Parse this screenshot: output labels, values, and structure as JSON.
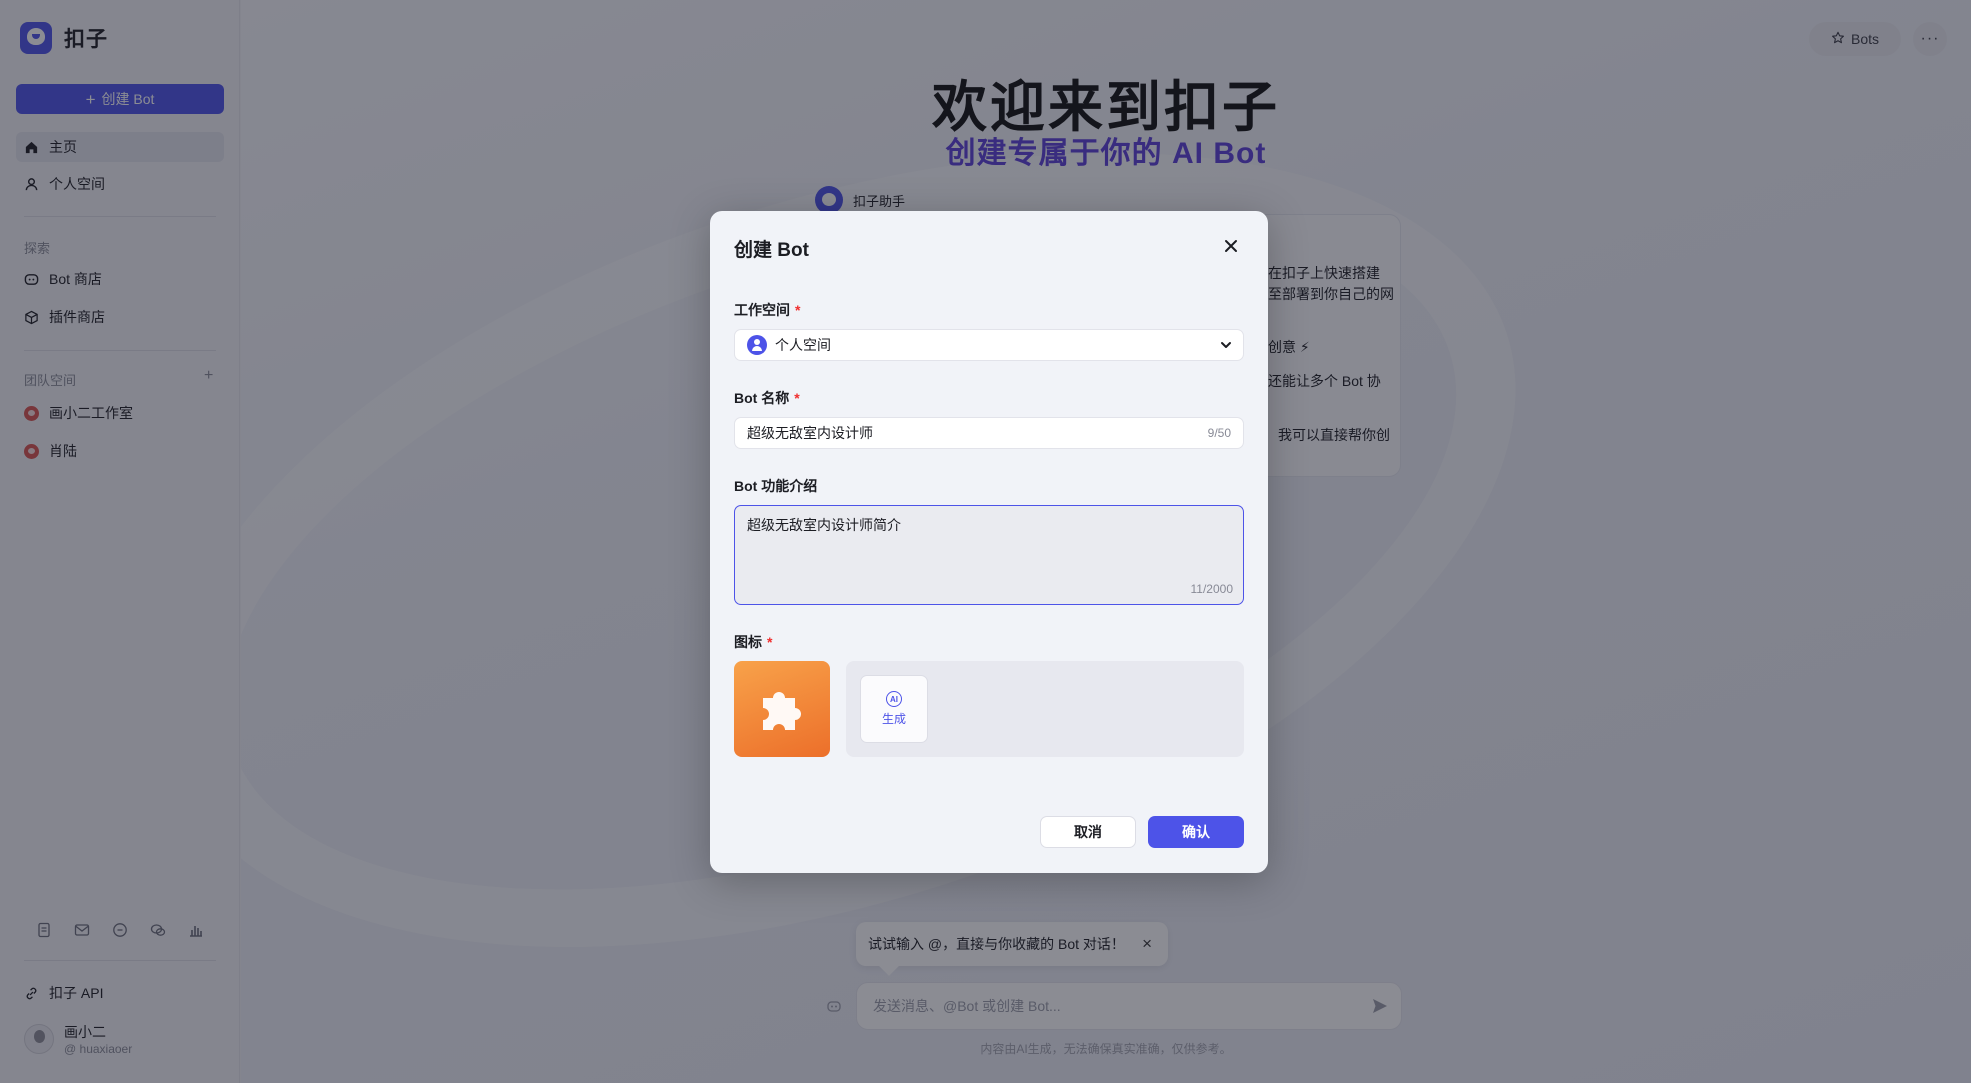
{
  "brand": {
    "name": "扣子"
  },
  "sidebar": {
    "create_label": "创建 Bot",
    "nav": [
      {
        "label": "主页",
        "icon": "home-icon",
        "active": true
      },
      {
        "label": "个人空间",
        "icon": "user-icon"
      }
    ],
    "explore_title": "探索",
    "explore": [
      {
        "label": "Bot 商店",
        "icon": "bot-icon"
      },
      {
        "label": "插件商店",
        "icon": "cube-icon"
      }
    ],
    "team_title": "团队空间",
    "team_add": "+",
    "teams": [
      {
        "label": "画小二工作室"
      },
      {
        "label": "肖陆"
      }
    ],
    "api_label": "扣子 API",
    "user": {
      "name": "画小二",
      "handle": "@ huaxiaoer"
    }
  },
  "header": {
    "bots_label": "Bots",
    "more_label": "···"
  },
  "hero": {
    "title": "欢迎来到扣子",
    "subtitle": "创建专属于你的 AI Bot"
  },
  "assistant": {
    "name": "扣子助手",
    "lines": [
      "在扣子上快速搭建",
      "至部署到你自己的网",
      "创意 ⚡",
      "还能让多个 Bot 协",
      "我可以直接帮你创"
    ]
  },
  "chat": {
    "tip": "试试输入 @，直接与你收藏的 Bot 对话！",
    "placeholder": "发送消息、@Bot 或创建 Bot...",
    "disclaimer": "内容由AI生成，无法确保真实准确，仅供参考。"
  },
  "modal": {
    "title": "创建 Bot",
    "workspace_label": "工作空间",
    "workspace_value": "个人空间",
    "name_label": "Bot 名称",
    "name_value": "超级无敌室内设计师",
    "name_counter": "9/50",
    "desc_label": "Bot 功能介绍",
    "desc_value": "超级无敌室内设计师简介",
    "desc_counter": "11/2000",
    "icon_label": "图标",
    "required_mark": "*",
    "generate_label": "生成",
    "ai_badge": "AI",
    "cancel_label": "取消",
    "confirm_label": "确认"
  },
  "colors": {
    "accent": "#4d53e8",
    "subtitle": "#5a3fd6",
    "required": "#f02d2d",
    "icon_bg": "#f08a3a"
  }
}
